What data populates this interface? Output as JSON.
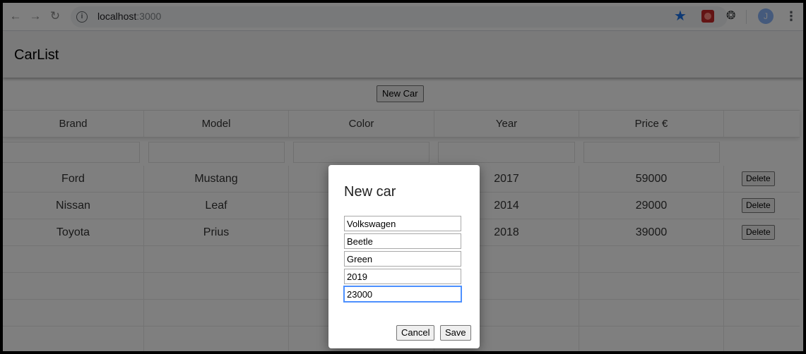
{
  "browser": {
    "url_host": "localhost",
    "url_port": ":3000",
    "avatar_letter": "J"
  },
  "app": {
    "title": "CarList",
    "new_car_label": "New Car"
  },
  "table": {
    "headers": [
      "Brand",
      "Model",
      "Color",
      "Year",
      "Price €"
    ],
    "rows": [
      {
        "brand": "Ford",
        "model": "Mustang",
        "color": "",
        "year": "2017",
        "price": "59000"
      },
      {
        "brand": "Nissan",
        "model": "Leaf",
        "color": "",
        "year": "2014",
        "price": "29000"
      },
      {
        "brand": "Toyota",
        "model": "Prius",
        "color": "",
        "year": "2018",
        "price": "39000"
      }
    ],
    "delete_label": "Delete"
  },
  "dialog": {
    "title": "New car",
    "fields": [
      "Volkswagen",
      "Beetle",
      "Green",
      "2019",
      "23000"
    ],
    "cancel_label": "Cancel",
    "save_label": "Save"
  },
  "colors": {
    "star": "#1a73e8",
    "overlay": "rgba(0,0,0,0.5)"
  }
}
